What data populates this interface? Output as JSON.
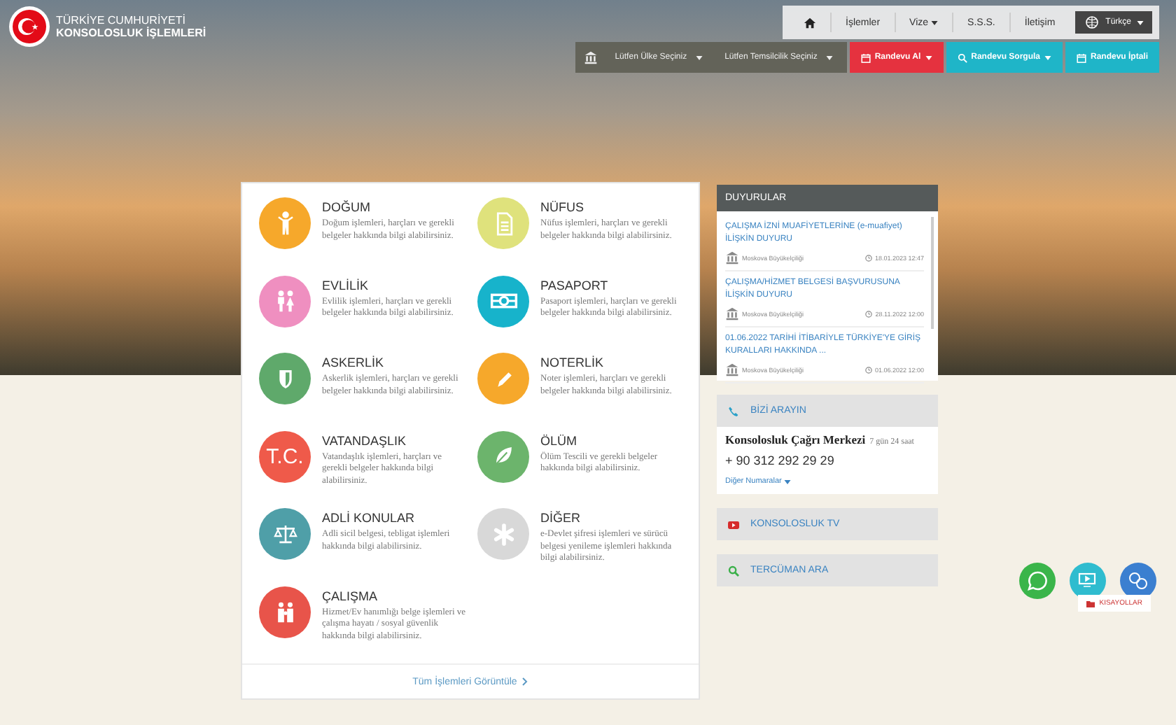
{
  "header": {
    "title_line1": "TÜRKİYE CUMHURİYETİ",
    "title_line2": "KONSOLOSLUK İŞLEMLERİ"
  },
  "nav": {
    "items": [
      {
        "label": "İşlemler",
        "dropdown": false
      },
      {
        "label": "Vize",
        "dropdown": true
      },
      {
        "label": "S.S.S.",
        "dropdown": false
      },
      {
        "label": "İletişim",
        "dropdown": false
      }
    ],
    "language": "Türkçe"
  },
  "selectors": [
    {
      "placeholder": "Lütfen Ülke Seçiniz"
    },
    {
      "placeholder": "Lütfen Temsilcilik Seçiniz"
    }
  ],
  "actions": [
    {
      "label": "Randevu Al",
      "color": "#e5323f",
      "dropdown": true
    },
    {
      "label": "Randevu Sorgula",
      "color": "#1fb5c8",
      "dropdown": true
    },
    {
      "label": "Randevu İptali",
      "color": "#1fb5c8",
      "dropdown": false
    }
  ],
  "services": [
    {
      "title": "DOĞUM",
      "description": "Doğum işlemleri, harçları ve gerekli belgeler hakkında bilgi alabilirsiniz.",
      "color": "#f6a82b"
    },
    {
      "title": "NÜFUS",
      "description": "Nüfus işlemleri, harçları ve gerekli belgeler hakkında bilgi alabilirsiniz.",
      "color": "#dfe27c"
    },
    {
      "title": "EVLİLİK",
      "description": "Evlilik işlemleri, harçları ve gerekli belgeler hakkında bilgi alabilirsiniz.",
      "color": "#ef8fc0"
    },
    {
      "title": "PASAPORT",
      "description": "Pasaport işlemleri, harçları ve gerekli belgeler hakkında bilgi alabilirsiniz.",
      "color": "#17b3cb"
    },
    {
      "title": "ASKERLİK",
      "description": "Askerlik işlemleri, harçları ve gerekli belgeler hakkında bilgi alabilirsiniz.",
      "color": "#5fa96b"
    },
    {
      "title": "NOTERLİK",
      "description": "Noter işlemleri, harçları ve gerekli belgeler hakkında bilgi alabilirsiniz.",
      "color": "#f6a82b"
    },
    {
      "title": "VATANDAŞLIK",
      "description": "Vatandaşlık işlemleri, harçları ve gerekli belgeler hakkında bilgi alabilirsiniz.",
      "color": "#ef5a4a",
      "icon_text": "T.C."
    },
    {
      "title": "ÖLÜM",
      "description": "Ölüm Tescili ve gerekli belgeler hakkında bilgi alabilirsiniz.",
      "color": "#6cb46c"
    },
    {
      "title": "ADLİ KONULAR",
      "description": "Adli sicil belgesi, tebligat işlemleri hakkında bilgi alabilirsiniz.",
      "color": "#4f9fa8"
    },
    {
      "title": "DİĞER",
      "description": "e-Devlet şifresi işlemleri ve sürücü belgesi yenileme işlemleri hakkında bilgi alabilirsiniz.",
      "color": "#d8d8d8"
    },
    {
      "title": "ÇALIŞMA",
      "description": "Hizmet/Ev hanımlığı belge işlemleri ve çalışma hayatı / sosyal güvenlik hakkında bilgi alabilirsiniz.",
      "color": "#e8544a"
    }
  ],
  "all_services_link": "Tüm İşlemleri Görüntüle",
  "announcements": {
    "title": "DUYURULAR",
    "items": [
      {
        "title": "ÇALIŞMA İZNİ MUAFİYETLERİNE (e-muafiyet) İLİŞKİN DUYURU",
        "source": "Moskova Büyükelçiliği",
        "date": "18.01.2023 12:47"
      },
      {
        "title": "ÇALIŞMA/HİZMET BELGESİ BAŞVURUSUNA İLİŞKİN DUYURU",
        "source": "Moskova Büyükelçiliği",
        "date": "28.11.2022 12:00"
      },
      {
        "title": "01.06.2022 TARİHİ İTİBARİYLE TÜRKİYE'YE GİRİŞ KURALLARI HAKKINDA ...",
        "source": "Moskova Büyükelçiliği",
        "date": "01.06.2022 12:00"
      }
    ]
  },
  "call_us": {
    "title": "BİZİ ARAYIN",
    "center": "Konsolosluk Çağrı Merkezi",
    "hours": "7 gün 24 saat",
    "phone": "+ 90 312 292 29 29",
    "more": "Diğer Numaralar"
  },
  "panels": [
    {
      "kind": "tv",
      "title": "KONSOLOSLUK TV"
    },
    {
      "kind": "search",
      "title": "TERCÜMAN ARA"
    }
  ],
  "shortcuts": {
    "label": "KISAYOLLAR"
  }
}
